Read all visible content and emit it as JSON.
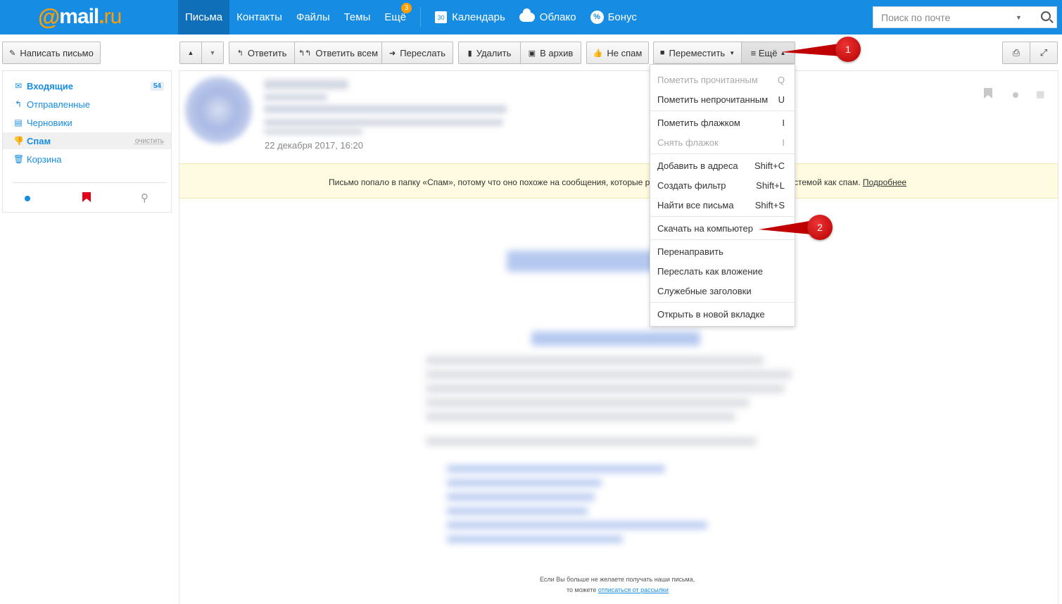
{
  "brand": {
    "at": "@",
    "mail": "mail",
    "dot": ".",
    "ru": "ru"
  },
  "nav": {
    "items": [
      {
        "label": "Письма"
      },
      {
        "label": "Контакты"
      },
      {
        "label": "Файлы"
      },
      {
        "label": "Темы"
      },
      {
        "label": "Ещё",
        "badge": "3"
      }
    ],
    "services": [
      {
        "label": "Календарь",
        "icon": "calendar-icon",
        "icon_text": "30"
      },
      {
        "label": "Облако",
        "icon": "cloud-icon"
      },
      {
        "label": "Бонус",
        "icon": "bonus-icon",
        "icon_text": "%"
      }
    ]
  },
  "search": {
    "placeholder": "Поиск по почте"
  },
  "toolbar": {
    "compose": "Написать письмо",
    "reply": "Ответить",
    "reply_all": "Ответить всем",
    "forward": "Переслать",
    "delete": "Удалить",
    "archive": "В архив",
    "not_spam": "Не спам",
    "move": "Переместить",
    "more": "≡ Ещё"
  },
  "sidebar": {
    "folders": [
      {
        "label": "Входящие",
        "count": "54"
      },
      {
        "label": "Отправленные"
      },
      {
        "label": "Черновики"
      },
      {
        "label": "Спам",
        "action": "очистить"
      },
      {
        "label": "Корзина"
      }
    ]
  },
  "message": {
    "date": "22 декабря 2017, 16:20",
    "spam_notice_part1": "Письмо попало в папку «Спам», потому что оно похоже на сообщения, которые р",
    "spam_notice_part2": "стемой как спам.",
    "spam_notice_link": "Подробнее",
    "footer_line1": "Если Вы больше не желаете получать наши письма,",
    "footer_line2_prefix": "то можете",
    "footer_link": "отписаться от рассылки"
  },
  "dropdown": {
    "items": [
      {
        "label": "Пометить прочитанным",
        "key": "Q",
        "disabled": true
      },
      {
        "label": "Пометить непрочитанным",
        "key": "U"
      },
      {
        "label": "Пометить флажком",
        "key": "I"
      },
      {
        "label": "Снять флажок",
        "key": "I",
        "disabled": true
      },
      {
        "label": "Добавить в адреса",
        "key": "Shift+C"
      },
      {
        "label": "Создать фильтр",
        "key": "Shift+L"
      },
      {
        "label": "Найти все письма",
        "key": "Shift+S"
      },
      {
        "label": "Скачать на компьютер"
      },
      {
        "label": "Перенаправить"
      },
      {
        "label": "Переслать как вложение"
      },
      {
        "label": "Служебные заголовки"
      },
      {
        "label": "Открыть в новой вкладке"
      }
    ]
  },
  "annotations": [
    {
      "label": "1"
    },
    {
      "label": "2"
    }
  ],
  "colors": {
    "brand_blue": "#168de2",
    "active_nav": "#0f6fb8",
    "accent_orange": "#ff9e00",
    "callout_red": "#c00000",
    "notice_bg": "#fffbe0"
  }
}
